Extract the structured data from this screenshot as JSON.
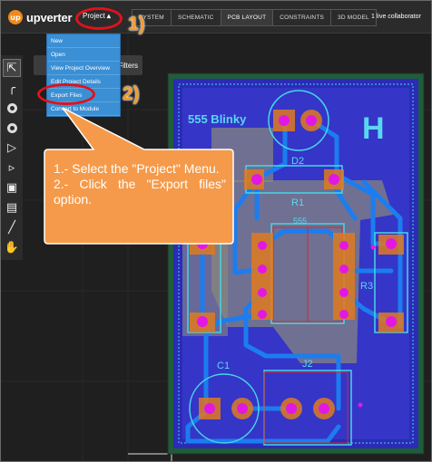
{
  "app": {
    "name": "upverter",
    "logo_glyph": "up"
  },
  "project_menu": {
    "label": "Project",
    "items": [
      {
        "label": "New"
      },
      {
        "label": "Open"
      },
      {
        "label": "View Project Overview"
      },
      {
        "label": "Edit Project Details"
      },
      {
        "label": "Export Files"
      },
      {
        "label": "Convert to Module"
      }
    ]
  },
  "tabs": [
    {
      "label": "SYSTEM",
      "active": false
    },
    {
      "label": "SCHEMATIC",
      "active": false
    },
    {
      "label": "PCB LAYOUT",
      "active": true
    },
    {
      "label": "CONSTRAINTS",
      "active": false
    },
    {
      "label": "3D MODEL",
      "active": false
    }
  ],
  "collaborator": "1 live collaborator",
  "filters": {
    "label": "Filters"
  },
  "tools": [
    {
      "icon": "select-arrow-icon"
    },
    {
      "icon": "route-trace-icon"
    },
    {
      "icon": "via-icon"
    },
    {
      "icon": "pad-icon"
    },
    {
      "icon": "polygon-icon"
    },
    {
      "icon": "keepout-icon"
    },
    {
      "icon": "image-icon"
    },
    {
      "icon": "text-icon"
    },
    {
      "icon": "ruler-icon"
    },
    {
      "icon": "hand-pan-icon"
    }
  ],
  "annotations": {
    "step1": "1)",
    "step2": "2)",
    "callout_line1": "1.- Select the \"Project\" Menu.",
    "callout_line2": "2.- Click the \"Export files\" option."
  },
  "pcb": {
    "board_title": "555 Blinky",
    "logo": "H",
    "labels": {
      "d2": "D2",
      "r1": "R1",
      "u1": "555",
      "r3": "R3",
      "c1": "C1",
      "j2": "J2"
    }
  },
  "colors": {
    "board": "#2b2bb8",
    "copper_pour": "#2f3fc4",
    "trace": "#1b7df0",
    "pad": "#e07a20",
    "pad_center": "#e317e3",
    "silkscreen": "#44d6e6",
    "annotation_red": "#e0121b",
    "callout_orange": "#f59a4a",
    "menu_blue": "#3b8fd4"
  }
}
